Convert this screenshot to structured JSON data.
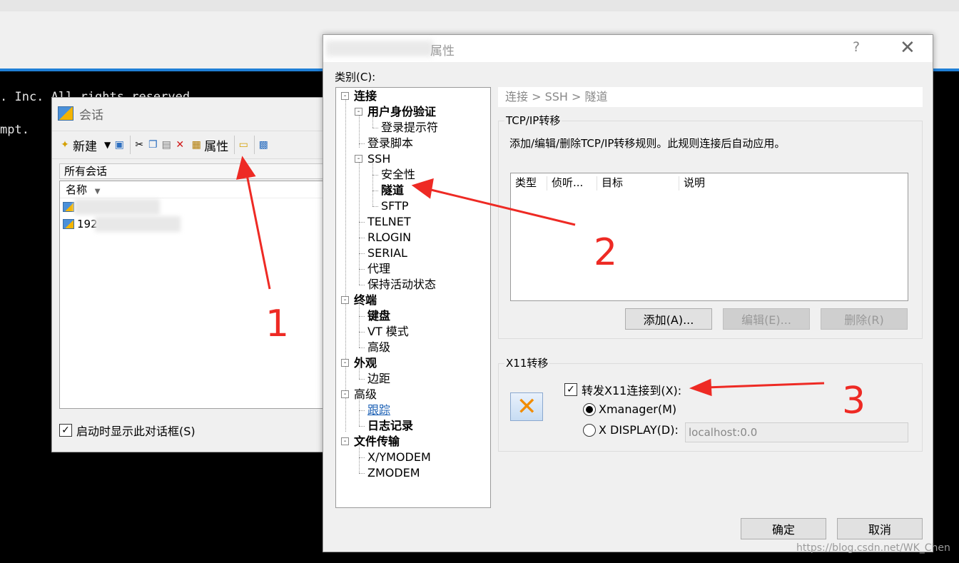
{
  "background": {
    "terminal_lines": [
      ". Inc. All rights reserved.",
      "mpt."
    ]
  },
  "session_window": {
    "title": "会话",
    "toolbar": {
      "new_label": "新建",
      "properties_label": "属性"
    },
    "all_sessions_label": "所有会话",
    "column_name": "名称",
    "sessions": [
      "192"
    ],
    "show_on_startup_label": "启动时显示此对话框(S)",
    "show_on_startup_checked": true
  },
  "properties_dialog": {
    "title": "属性",
    "help_glyph": "?",
    "close_glyph": "✕",
    "category_label": "类别(C):",
    "tree": [
      {
        "label": "连接",
        "bold": true
      },
      {
        "label": "用户身份验证",
        "bold": true
      },
      {
        "label": "登录提示符"
      },
      {
        "label": "登录脚本"
      },
      {
        "label": "SSH"
      },
      {
        "label": "安全性"
      },
      {
        "label": "隧道",
        "bold": true,
        "selected": true
      },
      {
        "label": "SFTP"
      },
      {
        "label": "TELNET"
      },
      {
        "label": "RLOGIN"
      },
      {
        "label": "SERIAL"
      },
      {
        "label": "代理"
      },
      {
        "label": "保持活动状态"
      },
      {
        "label": "终端",
        "bold": true
      },
      {
        "label": "键盘",
        "bold": true
      },
      {
        "label": "VT 模式"
      },
      {
        "label": "高级"
      },
      {
        "label": "外观",
        "bold": true
      },
      {
        "label": "边距"
      },
      {
        "label": "高级"
      },
      {
        "label": "跟踪",
        "link": true
      },
      {
        "label": "日志记录",
        "bold": true
      },
      {
        "label": "文件传输",
        "bold": true
      },
      {
        "label": "X/YMODEM"
      },
      {
        "label": "ZMODEM"
      }
    ],
    "breadcrumb": "连接 > SSH > 隧道",
    "tcp_group": {
      "title": "TCP/IP转移",
      "description": "添加/编辑/删除TCP/IP转移规则。此规则连接后自动应用。",
      "columns": [
        "类型",
        "侦听...",
        "目标",
        "说明"
      ],
      "add_button": "添加(A)...",
      "edit_button": "编辑(E)...",
      "delete_button": "删除(R)"
    },
    "x11_group": {
      "title": "X11转移",
      "forward_label": "转发X11连接到(X):",
      "forward_checked": true,
      "xmanager_label": "Xmanager(M)",
      "xdisplay_label": "X DISPLAY(D):",
      "xdisplay_value": "localhost:0.0",
      "selected_option": "Xmanager(M)"
    },
    "ok_button": "确定",
    "cancel_button": "取消"
  },
  "annotations": {
    "labels": [
      "1",
      "2",
      "3"
    ],
    "color": "#ee2a24"
  },
  "watermark": "https://blog.csdn.net/WK_Chen"
}
